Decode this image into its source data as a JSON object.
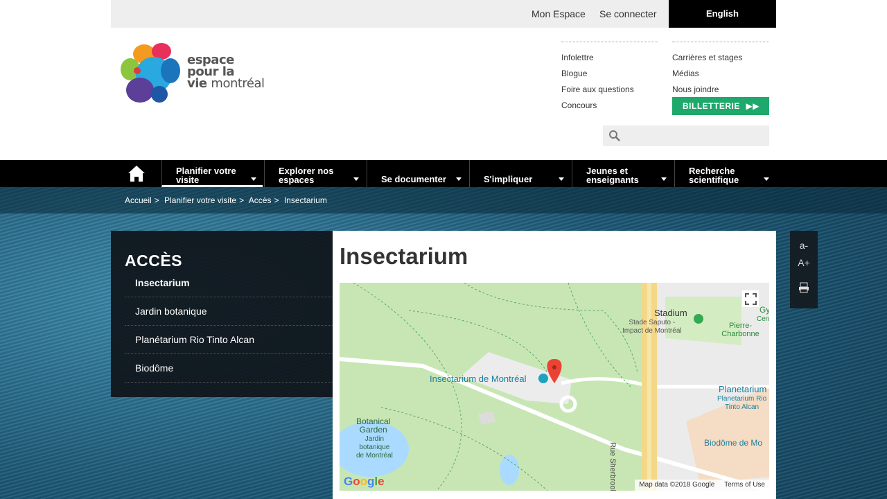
{
  "topbar": {
    "mon_espace": "Mon Espace",
    "connect": "Se connecter",
    "language": "English"
  },
  "logo": {
    "line1": "espace",
    "line2": "pour la",
    "line3a": "vie",
    "line3b": "montréal"
  },
  "header": {
    "col1": [
      "Infolettre",
      "Blogue",
      "Foire aux questions",
      "Concours"
    ],
    "col2": [
      "Carrières et stages",
      "Médias",
      "Nous joindre"
    ],
    "billetterie": "BILLETTERIE",
    "search_placeholder": ""
  },
  "nav": {
    "items": [
      {
        "l1": "Planifier votre",
        "l2": "visite",
        "active": true
      },
      {
        "l1": "Explorer nos",
        "l2": "espaces"
      },
      {
        "l1": "",
        "l2": "Se documenter"
      },
      {
        "l1": "",
        "l2": "S'impliquer"
      },
      {
        "l1": "Jeunes et",
        "l2": "enseignants"
      },
      {
        "l1": "Recherche",
        "l2": "scientifique"
      }
    ]
  },
  "breadcrumb": [
    "Accueil",
    "Planifier votre visite",
    "Accès",
    "Insectarium"
  ],
  "sidebar": {
    "title": "ACCÈS",
    "items": [
      "Insectarium",
      "Jardin botanique",
      "Planétarium Rio Tinto Alcan",
      "Biodôme"
    ]
  },
  "main": {
    "title": "Insectarium"
  },
  "map": {
    "labels": {
      "insectarium": "Insectarium de Montréal",
      "stadium": "Stadium",
      "saputo": "Stade Saputo -\nImpact de Montréal",
      "gy": "Gy",
      "cen": "Cen",
      "pierre": "Pierre-Charbonne",
      "planetarium": "Planetarium",
      "planetarium_sub": "Planetarium Rio\nTinto Alcan",
      "botanical": "Botanical\nGarden",
      "jardin": "Jardin\nbotanique\nde Montréal",
      "biodome": "Biodôme de Mo",
      "street": "Rue Sherbrooke E"
    },
    "attribution": "Map data ©2018 Google",
    "terms": "Terms of Use",
    "google": "Google"
  },
  "tools": {
    "smaller": "a-",
    "larger": "A+",
    "print_icon": "print-icon"
  },
  "colors": {
    "accent_green": "#1fa86b",
    "nav_bg": "#000000",
    "map_park": "#c8e6b4"
  }
}
